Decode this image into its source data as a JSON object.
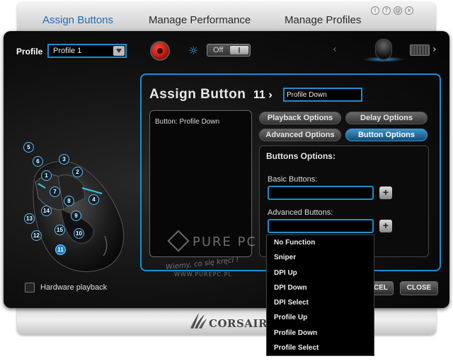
{
  "tabs": [
    {
      "label": "Assign Buttons",
      "active": true
    },
    {
      "label": "Manage Performance",
      "active": false
    },
    {
      "label": "Manage Profiles",
      "active": false
    }
  ],
  "window_icons": [
    "i",
    "?",
    "@",
    "x"
  ],
  "profile": {
    "label": "Profile",
    "value": "Profile 1"
  },
  "lighting_toggle": {
    "label": "Off"
  },
  "nav": {
    "prev": "‹",
    "next": "›"
  },
  "mouse_callouts": [
    "1",
    "2",
    "3",
    "4",
    "5",
    "6",
    "7",
    "8",
    "9",
    "10",
    "11",
    "12",
    "13",
    "14",
    "15"
  ],
  "selected_button": "11",
  "hardware_playback": {
    "label": "Hardware playback",
    "checked": false
  },
  "assign": {
    "title": "Assign Button",
    "number": "11 ›",
    "name_value": "Profile Down",
    "macro_text": "Button: Profile Down"
  },
  "option_tabs": [
    {
      "label": "Playback Options",
      "active": false
    },
    {
      "label": "Delay Options",
      "active": false
    },
    {
      "label": "Advanced Options",
      "active": false
    },
    {
      "label": "Button Options",
      "active": true
    }
  ],
  "buttons_options": {
    "title": "Buttons Options:",
    "basic_label": "Basic Buttons:",
    "advanced_label": "Advanced Buttons:",
    "plus": "+"
  },
  "dropdown_items": [
    "No Function",
    "Sniper",
    "DPI Up",
    "DPI Down",
    "DPI Select",
    "Profile Up",
    "Profile Down",
    "Profile Select"
  ],
  "actions": {
    "cancel": "CEL",
    "close": "CLOSE"
  },
  "watermark": {
    "name": "PURE PC",
    "tagline": "Wiemy, co się kręci !",
    "url": "WWW.PUREPC.PL"
  },
  "brand": {
    "name": "CORSAIR"
  },
  "colors": {
    "accent": "#1c8fd0",
    "record": "#d81e10",
    "panel": "#0a0a0a"
  }
}
